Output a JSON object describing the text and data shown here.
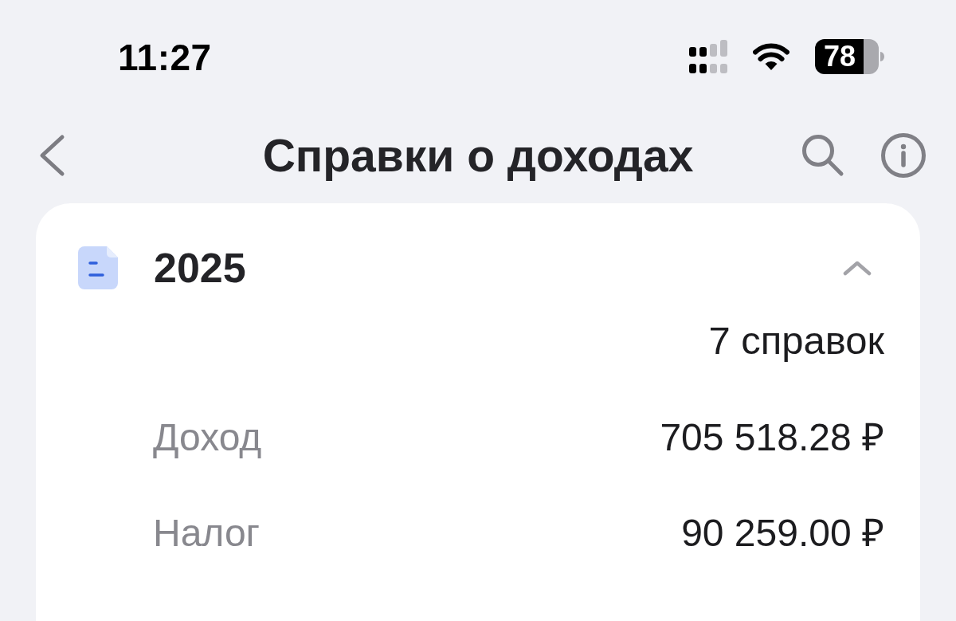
{
  "status_bar": {
    "time": "11:27",
    "battery": "78"
  },
  "nav_bar": {
    "title": "Справки о доходах"
  },
  "years": [
    {
      "year": "2025",
      "expanded": true,
      "count": "7 справок",
      "rows": [
        {
          "label": "Доход",
          "value": "705 518.28 ₽"
        },
        {
          "label": "Налог",
          "value": "90 259.00 ₽"
        }
      ]
    }
  ]
}
